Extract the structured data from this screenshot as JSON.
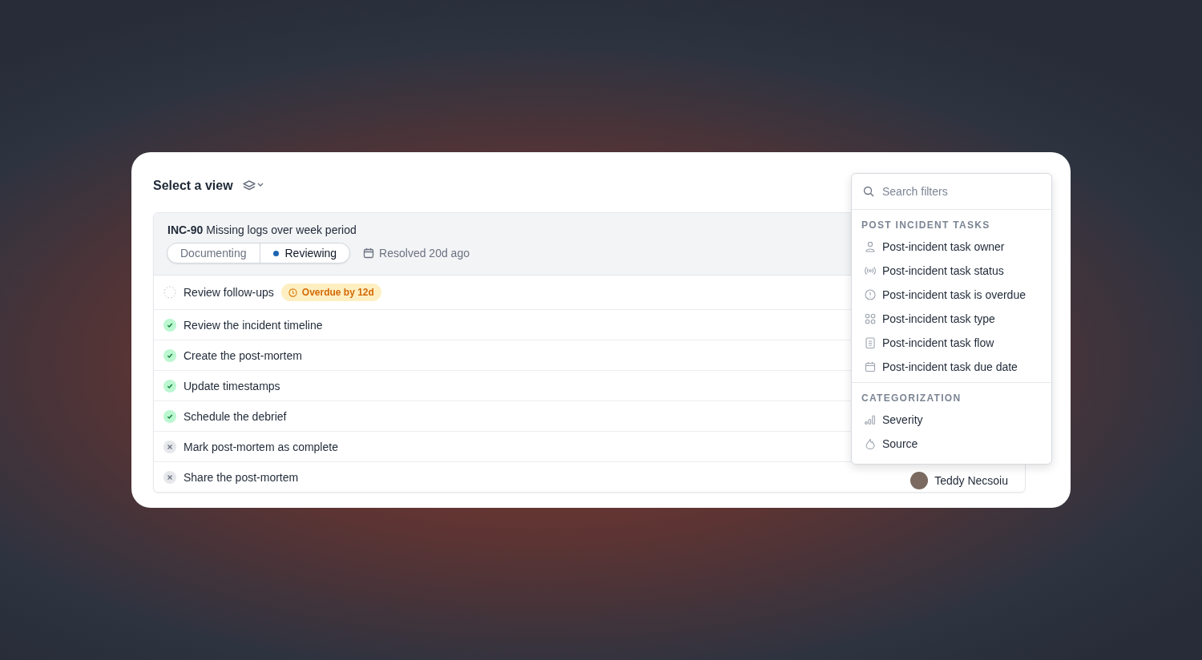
{
  "header": {
    "title": "Select a view"
  },
  "incident": {
    "id": "INC-90",
    "name": "Missing logs over week period",
    "steps": [
      {
        "label": "Documenting",
        "selected": false
      },
      {
        "label": "Reviewing",
        "selected": true
      }
    ],
    "resolved": "Resolved 20d ago"
  },
  "tasks": [
    {
      "name": "Review follow-ups",
      "kind": "pending",
      "badge": "Overdue by 12d"
    },
    {
      "name": "Review the incident timeline",
      "kind": "done"
    },
    {
      "name": "Create the post-mortem",
      "kind": "done"
    },
    {
      "name": "Update timestamps",
      "kind": "done"
    },
    {
      "name": "Schedule the debrief",
      "kind": "done"
    },
    {
      "name": "Mark post-mortem as complete",
      "kind": "cancelled"
    },
    {
      "name": "Share the post-mortem",
      "kind": "cancelled",
      "owner": "Teddy Necsoiu"
    }
  ],
  "filter_menu": {
    "search": {
      "placeholder": "Search filters"
    },
    "groups": [
      {
        "heading": "POST INCIDENT TASKS",
        "items": [
          {
            "label": "Post-incident task owner",
            "kind": "person"
          },
          {
            "label": "Post-incident task status",
            "kind": "signal"
          },
          {
            "label": "Post-incident task is overdue",
            "kind": "alert"
          },
          {
            "label": "Post-incident task type",
            "kind": "grid"
          },
          {
            "label": "Post-incident task flow",
            "kind": "clipboard"
          },
          {
            "label": "Post-incident task due date",
            "kind": "calendar"
          }
        ]
      },
      {
        "heading": "CATEGORIZATION",
        "items": [
          {
            "label": "Severity",
            "kind": "bars"
          },
          {
            "label": "Source",
            "kind": "flame"
          }
        ]
      }
    ]
  }
}
